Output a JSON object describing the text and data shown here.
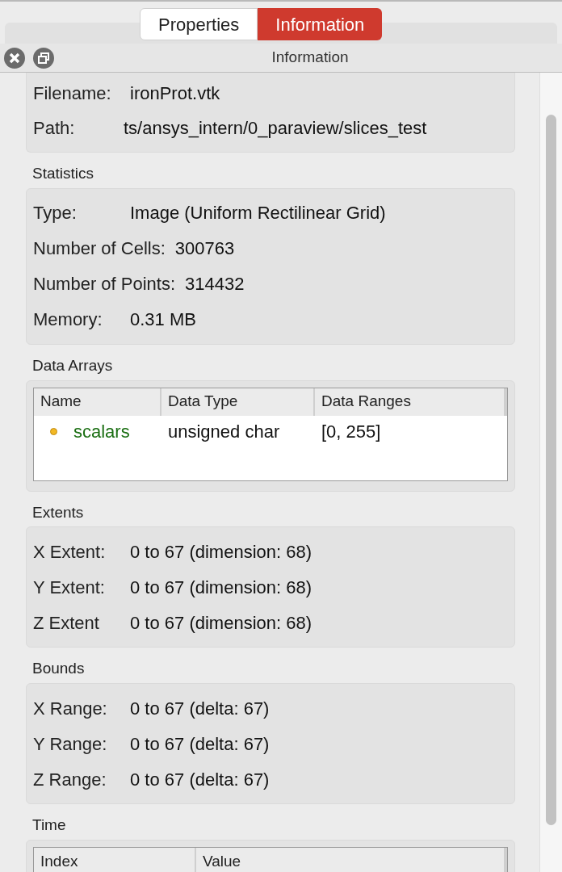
{
  "tabs": [
    {
      "label": "Properties",
      "selected": false
    },
    {
      "label": "Information",
      "selected": true
    }
  ],
  "panel": {
    "title": "Information"
  },
  "sections": [
    {
      "kind": "fields",
      "fields": [
        {
          "label": "Filename:",
          "value": "ironProt.vtk"
        },
        {
          "label": "Path:",
          "value": "ts/ansys_intern/0_paraview/slices_test"
        }
      ]
    },
    {
      "kind": "fields",
      "title": "Statistics",
      "fields": [
        {
          "label": "Type:",
          "value": "Image (Uniform Rectilinear Grid)"
        },
        {
          "label": "Number of Cells:",
          "value": "300763"
        },
        {
          "label": "Number of Points:",
          "value": "314432"
        },
        {
          "label": "Memory:",
          "value": "0.31 MB"
        }
      ]
    },
    {
      "kind": "table",
      "title": "Data Arrays",
      "columns": [
        "Name",
        "Data Type",
        "Data Ranges"
      ],
      "rows": [
        {
          "cells": [
            "scalars",
            "unsigned char",
            "[0, 255]"
          ],
          "color": "#f2b824"
        }
      ]
    },
    {
      "kind": "fields",
      "title": "Extents",
      "fields": [
        {
          "label": "X Extent:",
          "value": "0 to 67 (dimension: 68)"
        },
        {
          "label": "Y Extent:",
          "value": "0 to 67 (dimension: 68)"
        },
        {
          "label": "Z Extent",
          "value": "0 to 67 (dimension: 68)"
        }
      ]
    },
    {
      "kind": "fields",
      "title": "Bounds",
      "fields": [
        {
          "label": "X Range:",
          "value": "0 to 67 (delta: 67)"
        },
        {
          "label": "Y Range:",
          "value": "0 to 67 (delta: 67)"
        },
        {
          "label": "Z Range:",
          "value": "0 to 67 (delta: 67)"
        }
      ]
    },
    {
      "kind": "table",
      "title": "Time",
      "columns": [
        "Index",
        "Value"
      ]
    }
  ]
}
